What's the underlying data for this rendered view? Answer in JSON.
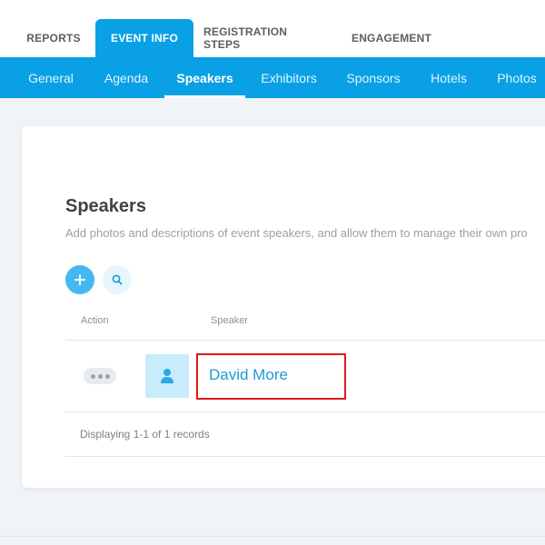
{
  "top_tabs": [
    {
      "label": "REPORTS"
    },
    {
      "label": "EVENT INFO"
    },
    {
      "label": "REGISTRATION STEPS"
    },
    {
      "label": "ENGAGEMENT"
    }
  ],
  "sub_nav": [
    {
      "label": "General"
    },
    {
      "label": "Agenda"
    },
    {
      "label": "Speakers"
    },
    {
      "label": "Exhibitors"
    },
    {
      "label": "Sponsors"
    },
    {
      "label": "Hotels"
    },
    {
      "label": "Photos"
    }
  ],
  "page": {
    "title": "Speakers",
    "description": "Add photos and descriptions of event speakers, and allow them to manage their own pro"
  },
  "table": {
    "columns": [
      "Action",
      "Speaker"
    ],
    "rows": [
      {
        "speaker_name": "David More"
      }
    ],
    "footer": "Displaying 1-1 of 1 records"
  },
  "icons": {
    "add": "plus-icon",
    "search": "search-icon",
    "actions": "more-horizontal-icon",
    "avatar": "user-icon"
  },
  "colors": {
    "accent": "#0aa0e6",
    "link": "#1b9ad8",
    "highlight": "#e01818"
  }
}
